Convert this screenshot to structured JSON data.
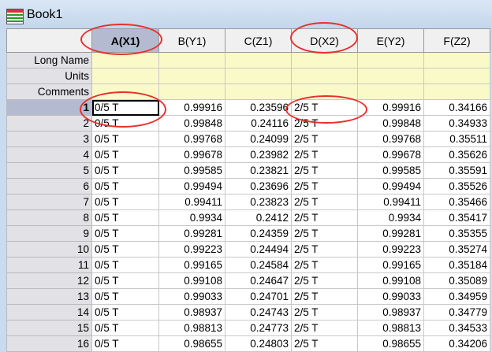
{
  "window": {
    "title": "Book1",
    "icon": "workbook-icon"
  },
  "columns": [
    "A(X1)",
    "B(Y1)",
    "C(Z1)",
    "D(X2)",
    "E(Y2)",
    "F(Z2)"
  ],
  "meta_rows": [
    "Long Name",
    "Units",
    "Comments"
  ],
  "rows": [
    [
      "1",
      "0/5 T",
      "0.99916",
      "0.23596",
      "2/5 T",
      "0.99916",
      "0.34166"
    ],
    [
      "2",
      "0/5 T",
      "0.99848",
      "0.24116",
      "2/5 T",
      "0.99848",
      "0.34933"
    ],
    [
      "3",
      "0/5 T",
      "0.99768",
      "0.24099",
      "2/5 T",
      "0.99768",
      "0.35511"
    ],
    [
      "4",
      "0/5 T",
      "0.99678",
      "0.23982",
      "2/5 T",
      "0.99678",
      "0.35626"
    ],
    [
      "5",
      "0/5 T",
      "0.99585",
      "0.23821",
      "2/5 T",
      "0.99585",
      "0.35591"
    ],
    [
      "6",
      "0/5 T",
      "0.99494",
      "0.23696",
      "2/5 T",
      "0.99494",
      "0.35526"
    ],
    [
      "7",
      "0/5 T",
      "0.99411",
      "0.23823",
      "2/5 T",
      "0.99411",
      "0.35466"
    ],
    [
      "8",
      "0/5 T",
      "0.9934",
      "0.2412",
      "2/5 T",
      "0.9934",
      "0.35417"
    ],
    [
      "9",
      "0/5 T",
      "0.99281",
      "0.24359",
      "2/5 T",
      "0.99281",
      "0.35355"
    ],
    [
      "10",
      "0/5 T",
      "0.99223",
      "0.24494",
      "2/5 T",
      "0.99223",
      "0.35274"
    ],
    [
      "11",
      "0/5 T",
      "0.99165",
      "0.24584",
      "2/5 T",
      "0.99165",
      "0.35184"
    ],
    [
      "12",
      "0/5 T",
      "0.99108",
      "0.24647",
      "2/5 T",
      "0.99108",
      "0.35089"
    ],
    [
      "13",
      "0/5 T",
      "0.99033",
      "0.24701",
      "2/5 T",
      "0.99033",
      "0.34959"
    ],
    [
      "14",
      "0/5 T",
      "0.98937",
      "0.24743",
      "2/5 T",
      "0.98937",
      "0.34779"
    ],
    [
      "15",
      "0/5 T",
      "0.98813",
      "0.24773",
      "2/5 T",
      "0.98813",
      "0.34533"
    ],
    [
      "16",
      "0/5 T",
      "0.98655",
      "0.24803",
      "2/5 T",
      "0.98655",
      "0.34206"
    ]
  ],
  "colors": {
    "annotation": "#e8302c",
    "meta_fill": "#fafac8",
    "selected": "#b4bbd0"
  }
}
